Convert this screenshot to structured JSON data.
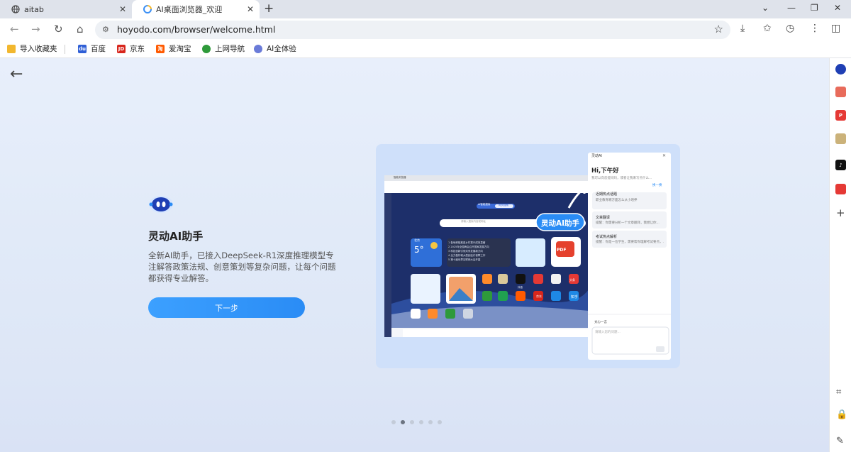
{
  "tabs": [
    {
      "title": "aitab",
      "active": false
    },
    {
      "title": "AI桌面浏览器_欢迎",
      "active": true
    }
  ],
  "toolbar": {
    "url": "hoyodo.com/browser/welcome.html"
  },
  "bookmarks": [
    {
      "label": "导入收藏夹",
      "icon": "folder-icon",
      "color": "#f2b72e"
    },
    {
      "label": "百度",
      "icon": "baidu-icon",
      "color": "#2f5fd6"
    },
    {
      "label": "京东",
      "icon": "jd-icon",
      "color": "#d8261c"
    },
    {
      "label": "爱淘宝",
      "icon": "taobao-icon",
      "color": "#ff5a00"
    },
    {
      "label": "上网导航",
      "icon": "navigation-icon",
      "color": "#2e9a3a"
    },
    {
      "label": "AI全体验",
      "icon": "ai-experience-icon",
      "color": "#6a7bd8"
    }
  ],
  "feature": {
    "title": "灵动AI助手",
    "description": "全新AI助手，已接入DeepSeek-R1深度推理模型专注解答政策法规、创意策划等复杂问题，让每个问题都获得专业解答。",
    "button": "下一步"
  },
  "preview": {
    "badge": "灵动AI助手",
    "panel": {
      "header": "灵动AI",
      "greeting": "Hi,下午好",
      "subtitle": "我可以向您提问吗，或者让我来写点什么...",
      "refresh": "换一换",
      "cards": [
        {
          "title": "近期热点话题",
          "body": "职业教育哪方面怎么从小培养"
        },
        {
          "title": "文章翻译",
          "body": "提醒：你需要分析一个文章翻译，我想让你..."
        },
        {
          "title": "考试热点解析",
          "body": "提醒：你是一位学生，需要帮你理解考试要点，..."
        }
      ],
      "model": "文心一言",
      "input_placeholder": "请输入您的问题..."
    },
    "browser": {
      "tab_title": "智能浏览器",
      "search_tabs": [
        "AI智能搜索",
        "网页搜索"
      ],
      "search_placeholder": "请输入搜索内容或网址",
      "news": [
        "1 各地积极推进乡村振兴成效显著",
        "2 2025年全国两会召开国家发展方向",
        "3 科技创新引领未来发展新方向",
        "4 全力做好城乡居民医疗保障工作",
        "5 第十届世界互联网大会开幕"
      ],
      "weather": {
        "temp": "5°",
        "city": "北京"
      },
      "apps": [
        "抖音",
        "知乎",
        "京东",
        "头条"
      ]
    }
  },
  "pagination": {
    "count": 6,
    "active": 1
  },
  "colors": {
    "accent": "#2a8cf5",
    "card": "#cfe0fa"
  }
}
